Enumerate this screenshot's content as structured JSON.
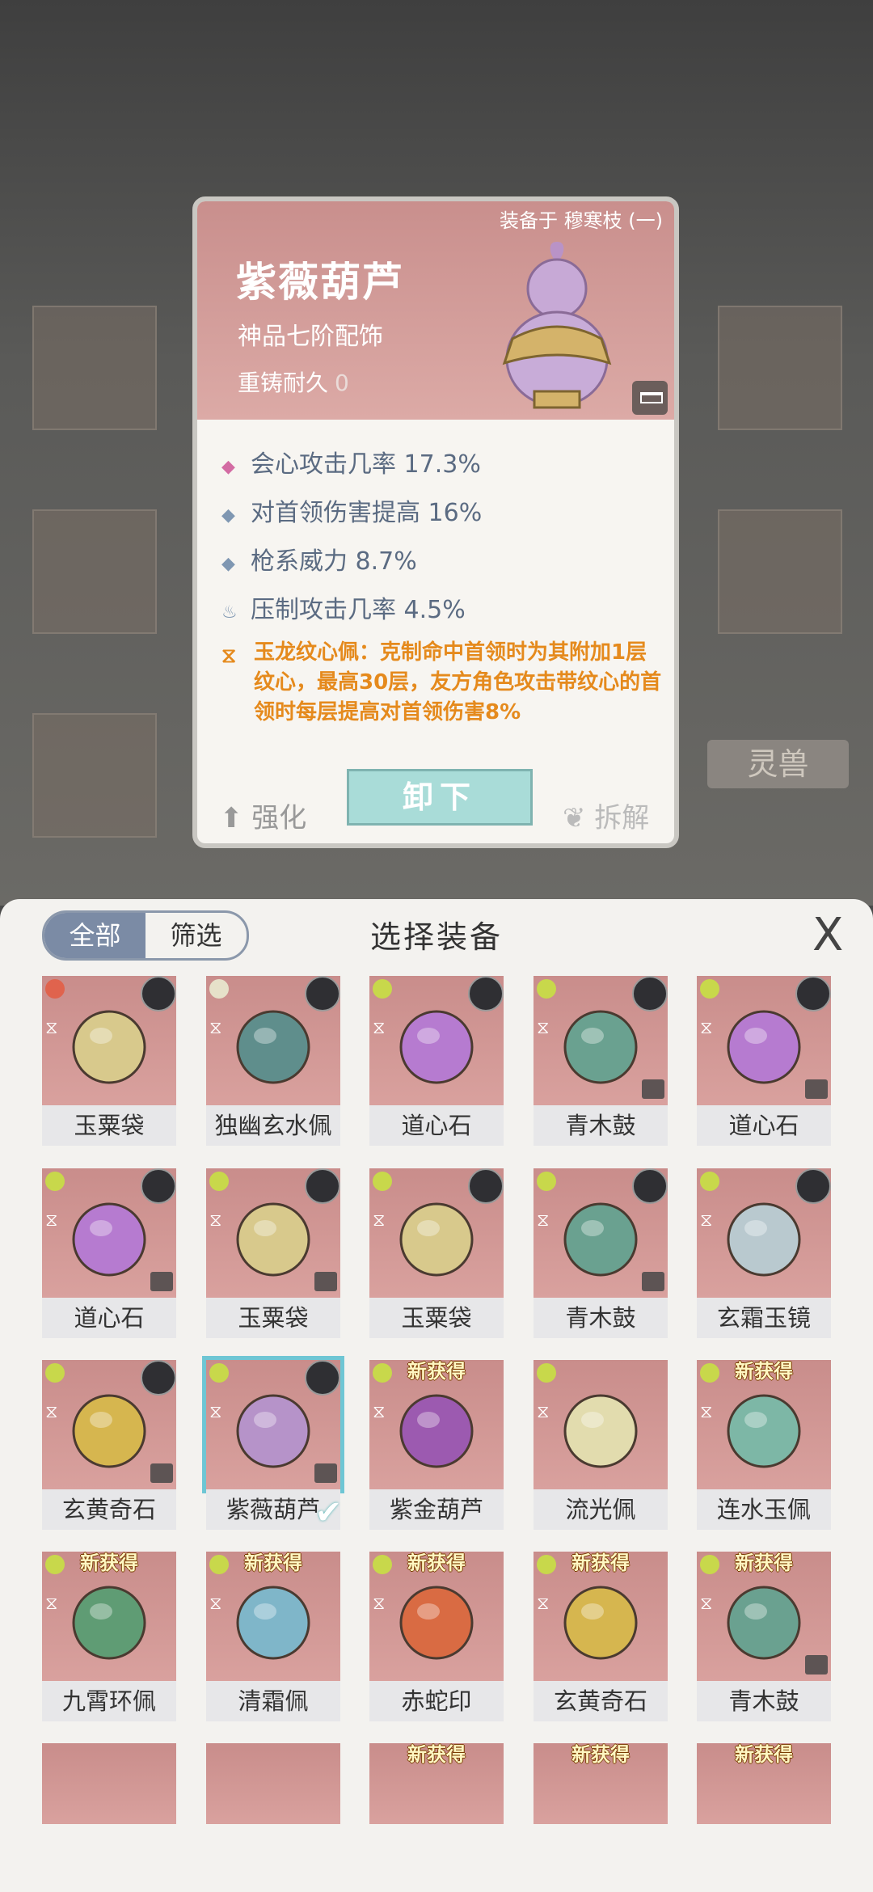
{
  "card": {
    "equip_info": "装备于 穆寒枝 (一)",
    "name": "紫薇葫芦",
    "grade": "神品七阶配饰",
    "durability_label": "重铸耐久",
    "durability_value": "0",
    "stats": [
      {
        "text": "会心攻击几率 17.3%",
        "color": "#d36ba3"
      },
      {
        "text": "对首领伤害提高 16%",
        "color": "#7f97b2"
      },
      {
        "text": "枪系威力 8.7%",
        "color": "#7f97b2"
      },
      {
        "text": "压制攻击几率 4.5%",
        "color": "#7f97b2"
      }
    ],
    "special": "玉龙纹心佩：克制命中首领时为其附加1层纹心，最高30层，友方角色攻击带纹心的首领时每层提高对首领伤害8%",
    "btn_strengthen": "强化",
    "btn_unequip": "卸下",
    "btn_dismantle": "拆解"
  },
  "bg": {
    "spirit_beast": "灵兽"
  },
  "panel": {
    "tab_all": "全部",
    "tab_filter": "筛选",
    "title": "选择装备",
    "close": "X",
    "new_label": "新获得",
    "items": [
      {
        "name": "玉粟袋",
        "color": "#d8c98c"
      },
      {
        "name": "独幽玄水佩",
        "color": "#5f8e8c"
      },
      {
        "name": "道心石",
        "color": "#b67bd0"
      },
      {
        "name": "青木鼓",
        "color": "#6aa190"
      },
      {
        "name": "道心石",
        "color": "#b67bd0"
      },
      {
        "name": "道心石",
        "color": "#b67bd0"
      },
      {
        "name": "玉粟袋",
        "color": "#d8c98c"
      },
      {
        "name": "玉粟袋",
        "color": "#d8c98c"
      },
      {
        "name": "青木鼓",
        "color": "#6aa190"
      },
      {
        "name": "玄霜玉镜",
        "color": "#b9c9cf"
      },
      {
        "name": "玄黄奇石",
        "color": "#d6b64f"
      },
      {
        "name": "紫薇葫芦",
        "color": "#b693c9"
      },
      {
        "name": "紫金葫芦",
        "color": "#9c5ab0"
      },
      {
        "name": "流光佩",
        "color": "#e2dcae"
      },
      {
        "name": "连水玉佩",
        "color": "#7db7a6"
      },
      {
        "name": "九霄环佩",
        "color": "#5f9c74"
      },
      {
        "name": "清霜佩",
        "color": "#7fb6c9"
      },
      {
        "name": "赤蛇印",
        "color": "#d96b43"
      },
      {
        "name": "玄黄奇石",
        "color": "#d6b64f"
      },
      {
        "name": "青木鼓",
        "color": "#6aa190"
      }
    ]
  }
}
